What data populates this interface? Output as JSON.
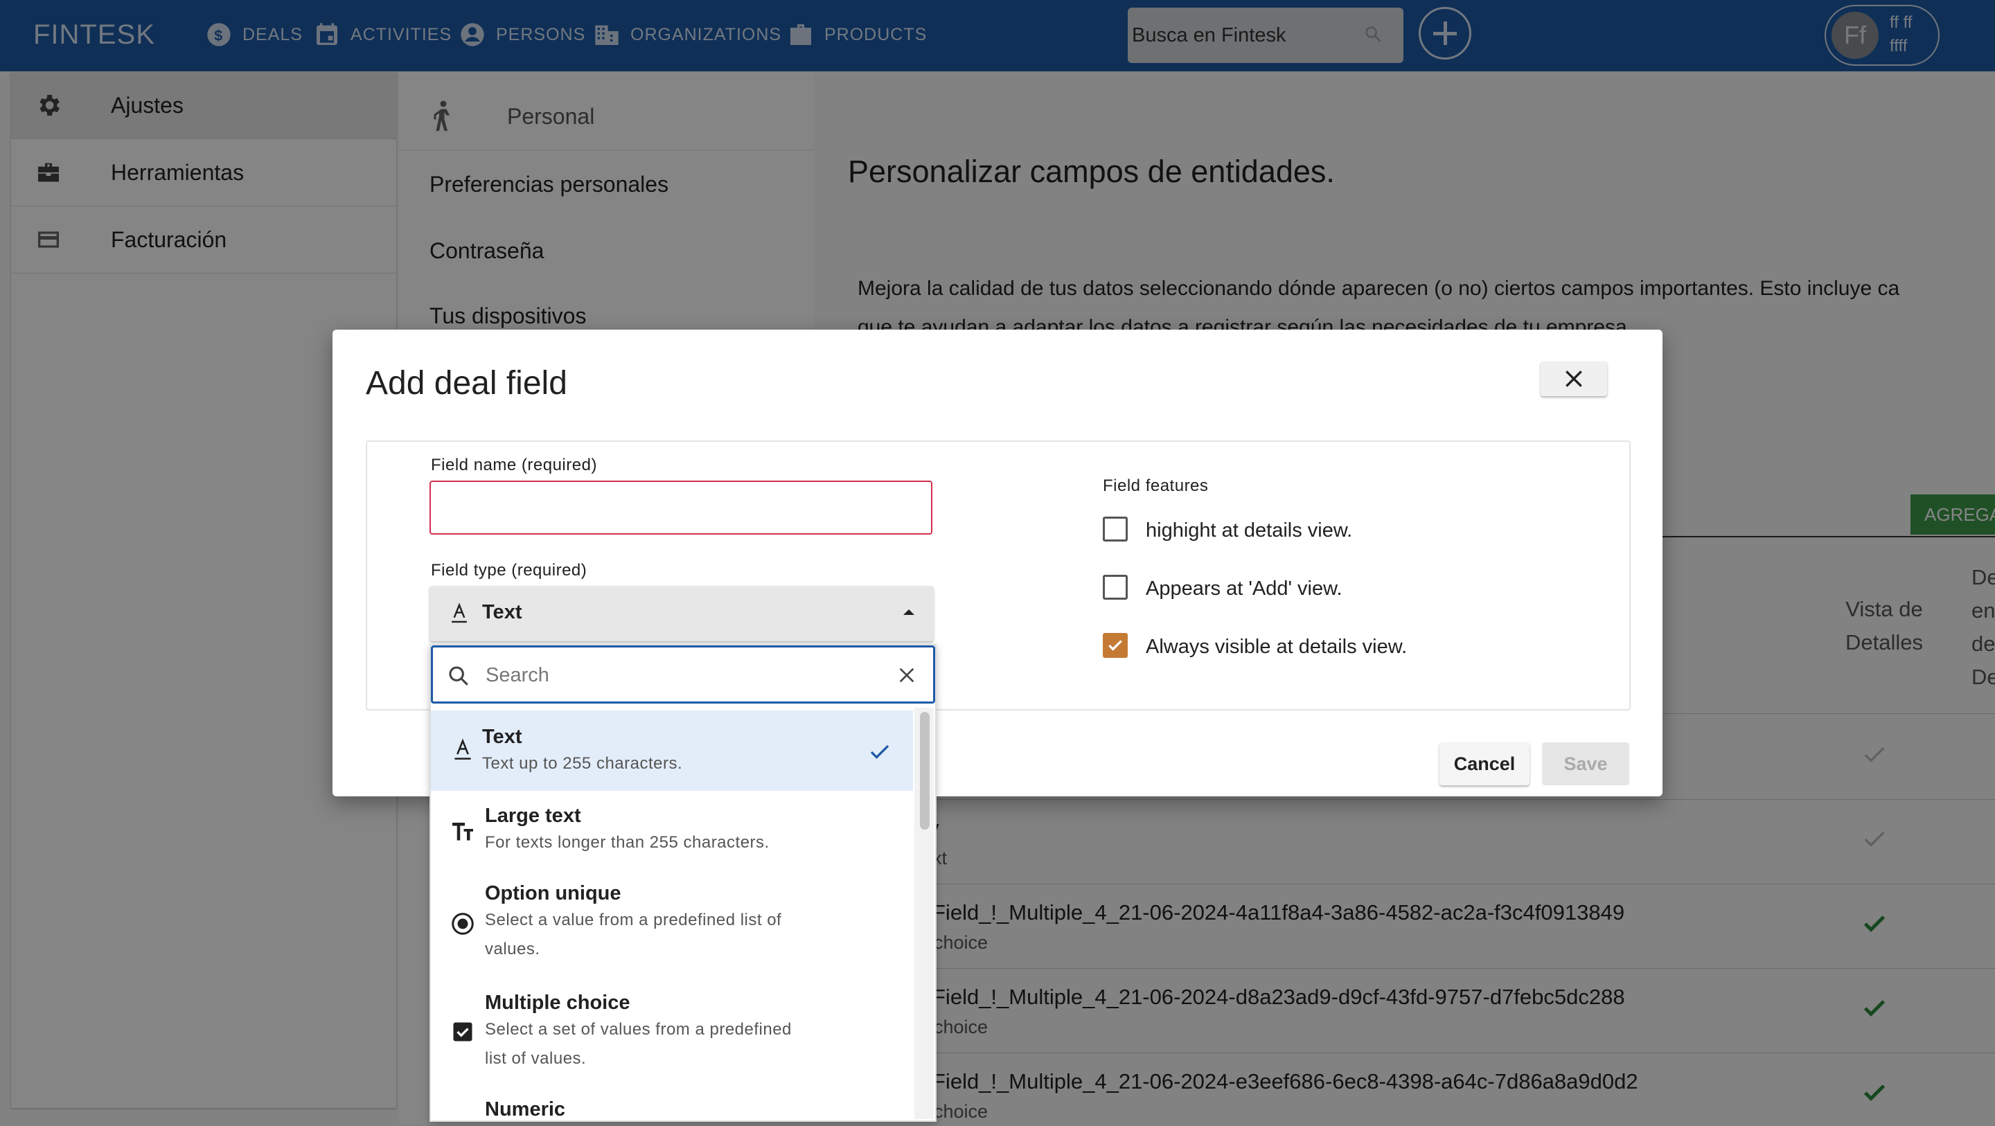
{
  "topbar": {
    "brand": "FINTESK",
    "nav": [
      {
        "label": "DEALS",
        "icon": "dollar-circle-icon"
      },
      {
        "label": "ACTIVITIES",
        "icon": "calendar-icon"
      },
      {
        "label": "PERSONS",
        "icon": "person-icon"
      },
      {
        "label": "ORGANIZATIONS",
        "icon": "building-icon"
      },
      {
        "label": "PRODUCTS",
        "icon": "briefcase-icon"
      }
    ],
    "search_placeholder": "Busca en Fintesk",
    "user": {
      "initials": "Ff",
      "name": "ff ff",
      "sub": "ffff"
    }
  },
  "left_nav": {
    "items": [
      {
        "label": "Ajustes",
        "icon": "gear-icon"
      },
      {
        "label": "Herramientas",
        "icon": "toolbox-icon"
      },
      {
        "label": "Facturación",
        "icon": "credit-card-icon"
      }
    ]
  },
  "mid_nav": {
    "header": "Personal",
    "items": [
      "Preferencias personales",
      "Contraseña",
      "Tus dispositivos"
    ]
  },
  "content": {
    "title": "Personalizar campos de entidades.",
    "desc_line1": "Mejora la calidad de tus datos seleccionando dónde aparecen (o no) ciertos campos importantes. Esto incluye ca",
    "desc_line2": "que te ayudan a adaptar los datos a registrar según las necesidades de tu empresa.",
    "add_button": "AGREGA",
    "col_header_1": "Vista de Detalles",
    "col_header_2": "De en de De",
    "rows": [
      {
        "name": "",
        "type": ""
      },
      {
        "name": "y",
        "type": "xt"
      },
      {
        "name": "Field_!_Multiple_4_21-06-2024-4a11f8a4-3a86-4582-ac2a-f3c4f0913849",
        "type": "choice"
      },
      {
        "name": "Field_!_Multiple_4_21-06-2024-d8a23ad9-d9cf-43fd-9757-d7febc5dc288",
        "type": "choice"
      },
      {
        "name": "Field_!_Multiple_4_21-06-2024-e3eef686-6ec8-4398-a64c-7d86a8a9d0d2",
        "type": "choice"
      }
    ]
  },
  "modal": {
    "title": "Add deal field",
    "field_name_label": "Field name (required)",
    "field_name_value": "",
    "field_type_label": "Field type (required)",
    "field_type_value": "Text",
    "features_label": "Field features",
    "features": [
      {
        "label": "highight at details view.",
        "checked": false
      },
      {
        "label": "Appears at 'Add' view.",
        "checked": false
      },
      {
        "label": "Always visible at details view.",
        "checked": true
      }
    ],
    "cancel_label": "Cancel",
    "save_label": "Save",
    "accent_color": "#c57a34"
  },
  "dropdown": {
    "search_placeholder": "Search",
    "options": [
      {
        "title": "Text",
        "desc": "Text up to 255 characters.",
        "icon": "text-format-icon",
        "selected": true
      },
      {
        "title": "Large text",
        "desc": "For texts longer than 255 characters.",
        "icon": "text-size-icon",
        "selected": false
      },
      {
        "title": "Option unique",
        "desc": "Select a value from a predefined list of values.",
        "icon": "radio-icon",
        "selected": false
      },
      {
        "title": "Multiple choice",
        "desc": "Select a set of values from a predefined list of values.",
        "icon": "checkbox-icon",
        "selected": false
      },
      {
        "title": "Numeric",
        "desc": "",
        "icon": "numeric-icon",
        "selected": false
      }
    ]
  }
}
